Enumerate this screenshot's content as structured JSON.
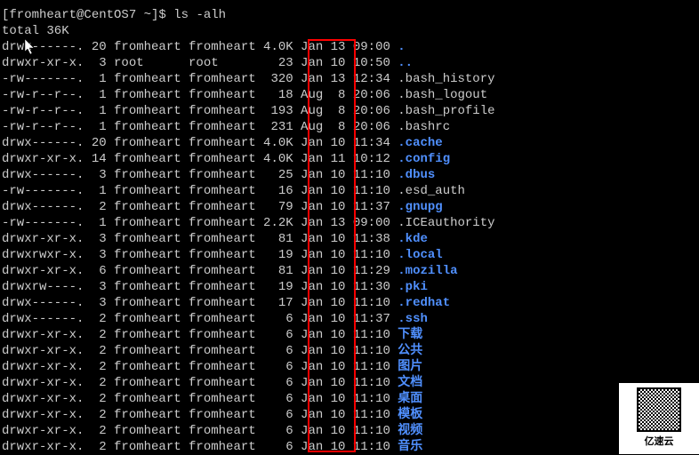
{
  "prompt": "[fromheart@CentOS7 ~]$ ",
  "command": "ls -alh",
  "total": "total 36K",
  "qr_label": "亿速云",
  "rows": [
    {
      "perms": "drwx------.",
      "links": "20",
      "owner": "fromheart",
      "group": "fromheart",
      "size": "4.0K",
      "date": "Jan 13 09:00",
      "name": ".",
      "c": "dir"
    },
    {
      "perms": "drwxr-xr-x.",
      "links": "3",
      "owner": "root",
      "group": "root",
      "size": "23",
      "date": "Jan 10 10:50",
      "name": "..",
      "c": "dir"
    },
    {
      "perms": "-rw-------.",
      "links": "1",
      "owner": "fromheart",
      "group": "fromheart",
      "size": "320",
      "date": "Jan 13 12:34",
      "name": ".bash_history",
      "c": "whitefile"
    },
    {
      "perms": "-rw-r--r--.",
      "links": "1",
      "owner": "fromheart",
      "group": "fromheart",
      "size": "18",
      "date": "Aug  8 20:06",
      "name": ".bash_logout",
      "c": "whitefile"
    },
    {
      "perms": "-rw-r--r--.",
      "links": "1",
      "owner": "fromheart",
      "group": "fromheart",
      "size": "193",
      "date": "Aug  8 20:06",
      "name": ".bash_profile",
      "c": "whitefile"
    },
    {
      "perms": "-rw-r--r--.",
      "links": "1",
      "owner": "fromheart",
      "group": "fromheart",
      "size": "231",
      "date": "Aug  8 20:06",
      "name": ".bashrc",
      "c": "whitefile"
    },
    {
      "perms": "drwx------.",
      "links": "20",
      "owner": "fromheart",
      "group": "fromheart",
      "size": "4.0K",
      "date": "Jan 10 11:34",
      "name": ".cache",
      "c": "dir"
    },
    {
      "perms": "drwxr-xr-x.",
      "links": "14",
      "owner": "fromheart",
      "group": "fromheart",
      "size": "4.0K",
      "date": "Jan 11 10:12",
      "name": ".config",
      "c": "dir"
    },
    {
      "perms": "drwx------.",
      "links": "3",
      "owner": "fromheart",
      "group": "fromheart",
      "size": "25",
      "date": "Jan 10 11:10",
      "name": ".dbus",
      "c": "dir"
    },
    {
      "perms": "-rw-------.",
      "links": "1",
      "owner": "fromheart",
      "group": "fromheart",
      "size": "16",
      "date": "Jan 10 11:10",
      "name": ".esd_auth",
      "c": "whitefile"
    },
    {
      "perms": "drwx------.",
      "links": "2",
      "owner": "fromheart",
      "group": "fromheart",
      "size": "79",
      "date": "Jan 10 11:37",
      "name": ".gnupg",
      "c": "dir"
    },
    {
      "perms": "-rw-------.",
      "links": "1",
      "owner": "fromheart",
      "group": "fromheart",
      "size": "2.2K",
      "date": "Jan 13 09:00",
      "name": ".ICEauthority",
      "c": "whitefile"
    },
    {
      "perms": "drwxr-xr-x.",
      "links": "3",
      "owner": "fromheart",
      "group": "fromheart",
      "size": "81",
      "date": "Jan 10 11:38",
      "name": ".kde",
      "c": "dir"
    },
    {
      "perms": "drwxrwxr-x.",
      "links": "3",
      "owner": "fromheart",
      "group": "fromheart",
      "size": "19",
      "date": "Jan 10 11:10",
      "name": ".local",
      "c": "dir"
    },
    {
      "perms": "drwxr-xr-x.",
      "links": "6",
      "owner": "fromheart",
      "group": "fromheart",
      "size": "81",
      "date": "Jan 10 11:29",
      "name": ".mozilla",
      "c": "dir"
    },
    {
      "perms": "drwxrw----.",
      "links": "3",
      "owner": "fromheart",
      "group": "fromheart",
      "size": "19",
      "date": "Jan 10 11:30",
      "name": ".pki",
      "c": "dir"
    },
    {
      "perms": "drwx------.",
      "links": "3",
      "owner": "fromheart",
      "group": "fromheart",
      "size": "17",
      "date": "Jan 10 11:10",
      "name": ".redhat",
      "c": "dir"
    },
    {
      "perms": "drwx------.",
      "links": "2",
      "owner": "fromheart",
      "group": "fromheart",
      "size": "6",
      "date": "Jan 10 11:37",
      "name": ".ssh",
      "c": "dir"
    },
    {
      "perms": "drwxr-xr-x.",
      "links": "2",
      "owner": "fromheart",
      "group": "fromheart",
      "size": "6",
      "date": "Jan 10 11:10",
      "name": "下载",
      "c": "dir"
    },
    {
      "perms": "drwxr-xr-x.",
      "links": "2",
      "owner": "fromheart",
      "group": "fromheart",
      "size": "6",
      "date": "Jan 10 11:10",
      "name": "公共",
      "c": "dir"
    },
    {
      "perms": "drwxr-xr-x.",
      "links": "2",
      "owner": "fromheart",
      "group": "fromheart",
      "size": "6",
      "date": "Jan 10 11:10",
      "name": "图片",
      "c": "dir"
    },
    {
      "perms": "drwxr-xr-x.",
      "links": "2",
      "owner": "fromheart",
      "group": "fromheart",
      "size": "6",
      "date": "Jan 10 11:10",
      "name": "文档",
      "c": "dir"
    },
    {
      "perms": "drwxr-xr-x.",
      "links": "2",
      "owner": "fromheart",
      "group": "fromheart",
      "size": "6",
      "date": "Jan 10 11:10",
      "name": "桌面",
      "c": "dir"
    },
    {
      "perms": "drwxr-xr-x.",
      "links": "2",
      "owner": "fromheart",
      "group": "fromheart",
      "size": "6",
      "date": "Jan 10 11:10",
      "name": "模板",
      "c": "dir"
    },
    {
      "perms": "drwxr-xr-x.",
      "links": "2",
      "owner": "fromheart",
      "group": "fromheart",
      "size": "6",
      "date": "Jan 10 11:10",
      "name": "视频",
      "c": "dir"
    },
    {
      "perms": "drwxr-xr-x.",
      "links": "2",
      "owner": "fromheart",
      "group": "fromheart",
      "size": "6",
      "date": "Jan 10 11:10",
      "name": "音乐",
      "c": "dir"
    }
  ]
}
